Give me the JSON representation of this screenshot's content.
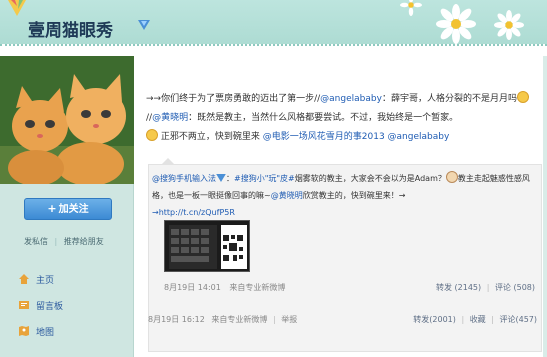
{
  "header": {
    "site_title": "壹周猫眼秀",
    "badge_icon": "vip-verified-icon"
  },
  "sidebar": {
    "follow_button": "加关注",
    "links": [
      "发私信",
      "推荐给朋友"
    ],
    "separator": "|",
    "nav": [
      {
        "label": "主页",
        "icon": "home-icon"
      },
      {
        "label": "留言板",
        "icon": "message-board-icon"
      },
      {
        "label": "地图",
        "icon": "map-icon"
      }
    ]
  },
  "post": {
    "arrow": "→→",
    "line1_a": "你们终于为了票房勇敢的迈出了第一步//",
    "mention1": "@angelababy",
    "line1_b": "：薛宇哥，人格分裂的不是月月吗",
    "line1_c": "//",
    "mention2": "@黄晓明",
    "line1_d": "：既然是教主，当然什么风格都要尝试。不过，我始终是一个暂家。",
    "line2_a": "正邪不两立，快到碗里来",
    "topic": "@电影一场风花雪月的事2013",
    "mention3": "@angelababy",
    "date": "8月19日 16:12",
    "source_prefix": "来自",
    "source": "专业新微博",
    "report": "举报",
    "repost": "转发(2001)",
    "favorite": "收藏",
    "comments": "评论(457)"
  },
  "quote": {
    "author": "@搜狗手机输入法",
    "text_a": "：",
    "topic": "#搜狗小\"玩\"皮#",
    "text_b": "烟雾软的教主，大家会不会以为是Adam？",
    "text_c": "教主走起魅惑性感风格，也是一板一眼挺像回事的嘛~",
    "mention": "@黄晓明",
    "text_d": "欣赏教主的，快到碗里来！→",
    "link": "→http://t.cn/zQufP5R",
    "date": "8月19日 14:01",
    "source_prefix": "来自",
    "source": "专业新微博",
    "repost": "转发 (2145)",
    "comments": "评论 (508)"
  }
}
